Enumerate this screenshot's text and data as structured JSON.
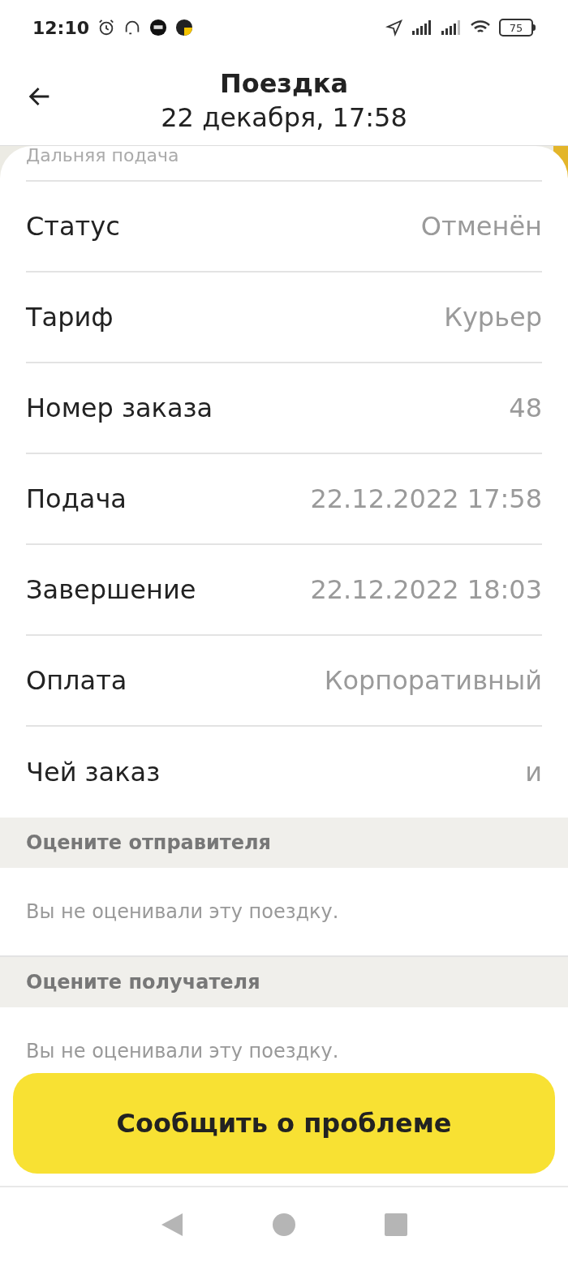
{
  "status_bar": {
    "time": "12:10",
    "battery": "75"
  },
  "header": {
    "title": "Поездка",
    "subtitle": "22 декабря, 17:58"
  },
  "details": {
    "partial_row": "Дальняя подача",
    "rows": [
      {
        "label": "Статус",
        "value": "Отменён"
      },
      {
        "label": "Тариф",
        "value": "Курьер"
      },
      {
        "label": "Номер заказа",
        "value": "48"
      },
      {
        "label": "Подача",
        "value": "22.12.2022 17:58"
      },
      {
        "label": "Завершение",
        "value": "22.12.2022 18:03"
      },
      {
        "label": "Оплата",
        "value": "Корпоративный"
      },
      {
        "label": "Чей заказ",
        "value": "и"
      }
    ]
  },
  "ratings": [
    {
      "title": "Оцените отправителя",
      "text": "Вы не оценивали эту поездку."
    },
    {
      "title": "Оцените получателя",
      "text": "Вы не оценивали эту поездку."
    }
  ],
  "report_button": "Сообщить о проблеме"
}
